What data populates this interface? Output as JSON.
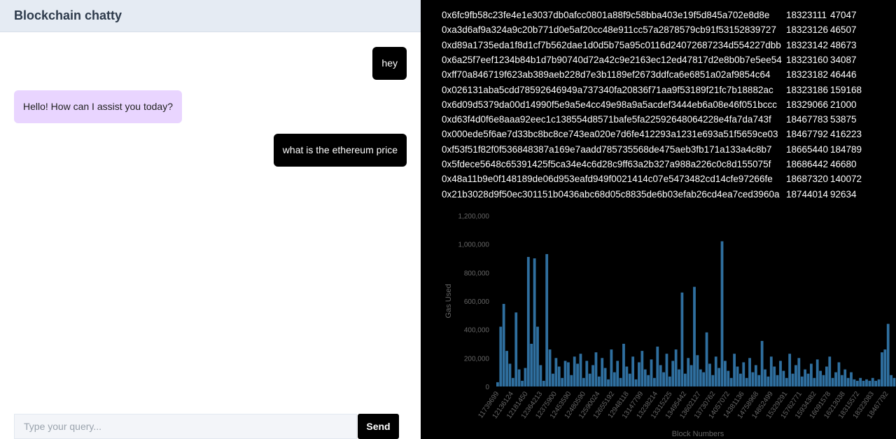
{
  "header": {
    "title": "Blockchain chatty"
  },
  "messages": [
    {
      "role": "user",
      "text": "hey"
    },
    {
      "role": "assistant",
      "text": "Hello! How can I assist you today?"
    },
    {
      "role": "user",
      "text": "what is the ethereum price"
    }
  ],
  "input": {
    "placeholder": "Type your query...",
    "value": "",
    "send_label": "Send"
  },
  "transactions": [
    [
      "0x6fc9fb58c23fe4e1e3037db0afcc0801a88f9c58bba403e19f5d845a702e8d8e",
      "18323111",
      "47047"
    ],
    [
      "0xa3d6af9a324a9c20b771d0e5af20cc48e911cc57a2878579cb91f53152839727",
      "18323126",
      "46507"
    ],
    [
      "0xd89a1735eda1f8d1cf7b562dae1d0d5b75a95c0116d24072687234d554227dbb",
      "18323142",
      "48673"
    ],
    [
      "0x6a25f7eef1234b84b1d7b90740d72a42c9e2163ec12ed47817d2e8b0b7e5ee54",
      "18323160",
      "34087"
    ],
    [
      "0xff70a846719f623ab389aeb228d7e3b1189ef2673ddfca6e6851a02af9854c64",
      "18323182",
      "46446"
    ],
    [
      "0x026131aba5cdd78592646949a737340fa20836f71aa9f53189f21fc7b18882ac",
      "18323186",
      "159168"
    ],
    [
      "0x6d09d5379da00d14990f5e9a5e4cc49e98a9a5acdef3444eb6a08e46f051bccc",
      "18329066",
      "21000"
    ],
    [
      "0xd63f4d0f6e8aaa92eec1c138554d8571bafe5fa22592648064228e4fa7da743f",
      "18467783",
      "53875"
    ],
    [
      "0x000ede5f6ae7d33bc8bc8ce743ea020e7d6fe412293a1231e693a51f5659ce03",
      "18467792",
      "416223"
    ],
    [
      "0xf53f51f82f0f536848387a169e7aadd785735568de475aeb3fb171a133a4c8b7",
      "18665440",
      "184789"
    ],
    [
      "0x5fdece5648c65391425f5ca34e4c6d28c9ff63a2b327a988a226c0c8d155075f",
      "18686442",
      "46680"
    ],
    [
      "0x48a11b9e0f148189de06d953eafd949f0021414c07e5473482cd14cfe97266fe",
      "18687320",
      "140072"
    ],
    [
      "0x21b3028d9f50ec301151b0436abc68d05c8835de6b03efab26cd4ea7ced3960a",
      "18744014",
      "92634"
    ]
  ],
  "chart_data": {
    "type": "bar",
    "xlabel": "Block Numbers",
    "ylabel": "Gas Used",
    "ylim": [
      0,
      1200000
    ],
    "yticks": [
      "0",
      "200,000",
      "400,000",
      "600,000",
      "800,000",
      "1,000,000",
      "1,200,000"
    ],
    "xtick_labels": [
      "11739699",
      "12136124",
      "12181450",
      "12364213",
      "12375900",
      "12453590",
      "12480590",
      "12590024",
      "12655192",
      "12948118",
      "13147799",
      "13238214",
      "13315225",
      "13495442",
      "13602127",
      "13730762",
      "14057072",
      "14381136",
      "14758968",
      "14852499",
      "15329291",
      "15762771",
      "15934382",
      "16091578",
      "16213038",
      "18315572",
      "18323083",
      "18467792"
    ],
    "bar_color": "#2f6f9f",
    "values": [
      30000,
      420000,
      580000,
      250000,
      160000,
      60000,
      520000,
      120000,
      40000,
      130000,
      910000,
      300000,
      900000,
      420000,
      150000,
      40000,
      930000,
      260000,
      90000,
      200000,
      140000,
      60000,
      180000,
      170000,
      80000,
      210000,
      160000,
      230000,
      60000,
      180000,
      90000,
      150000,
      240000,
      70000,
      200000,
      130000,
      50000,
      260000,
      100000,
      180000,
      60000,
      300000,
      140000,
      90000,
      210000,
      50000,
      170000,
      250000,
      120000,
      80000,
      190000,
      60000,
      280000,
      150000,
      100000,
      230000,
      70000,
      180000,
      260000,
      120000,
      660000,
      90000,
      200000,
      150000,
      700000,
      220000,
      120000,
      100000,
      380000,
      160000,
      80000,
      210000,
      130000,
      1020000,
      180000,
      110000,
      60000,
      230000,
      140000,
      90000,
      170000,
      60000,
      200000,
      100000,
      150000,
      80000,
      320000,
      120000,
      70000,
      210000,
      140000,
      80000,
      180000,
      110000,
      60000,
      230000,
      90000,
      150000,
      200000,
      70000,
      120000,
      90000,
      160000,
      60000,
      190000,
      110000,
      80000,
      140000,
      210000,
      60000,
      100000,
      170000,
      80000,
      120000,
      60000,
      100000,
      50000,
      40000,
      60000,
      40000,
      50000,
      40000,
      60000,
      40000,
      50000,
      240000,
      260000,
      440000,
      80000,
      60000
    ]
  }
}
